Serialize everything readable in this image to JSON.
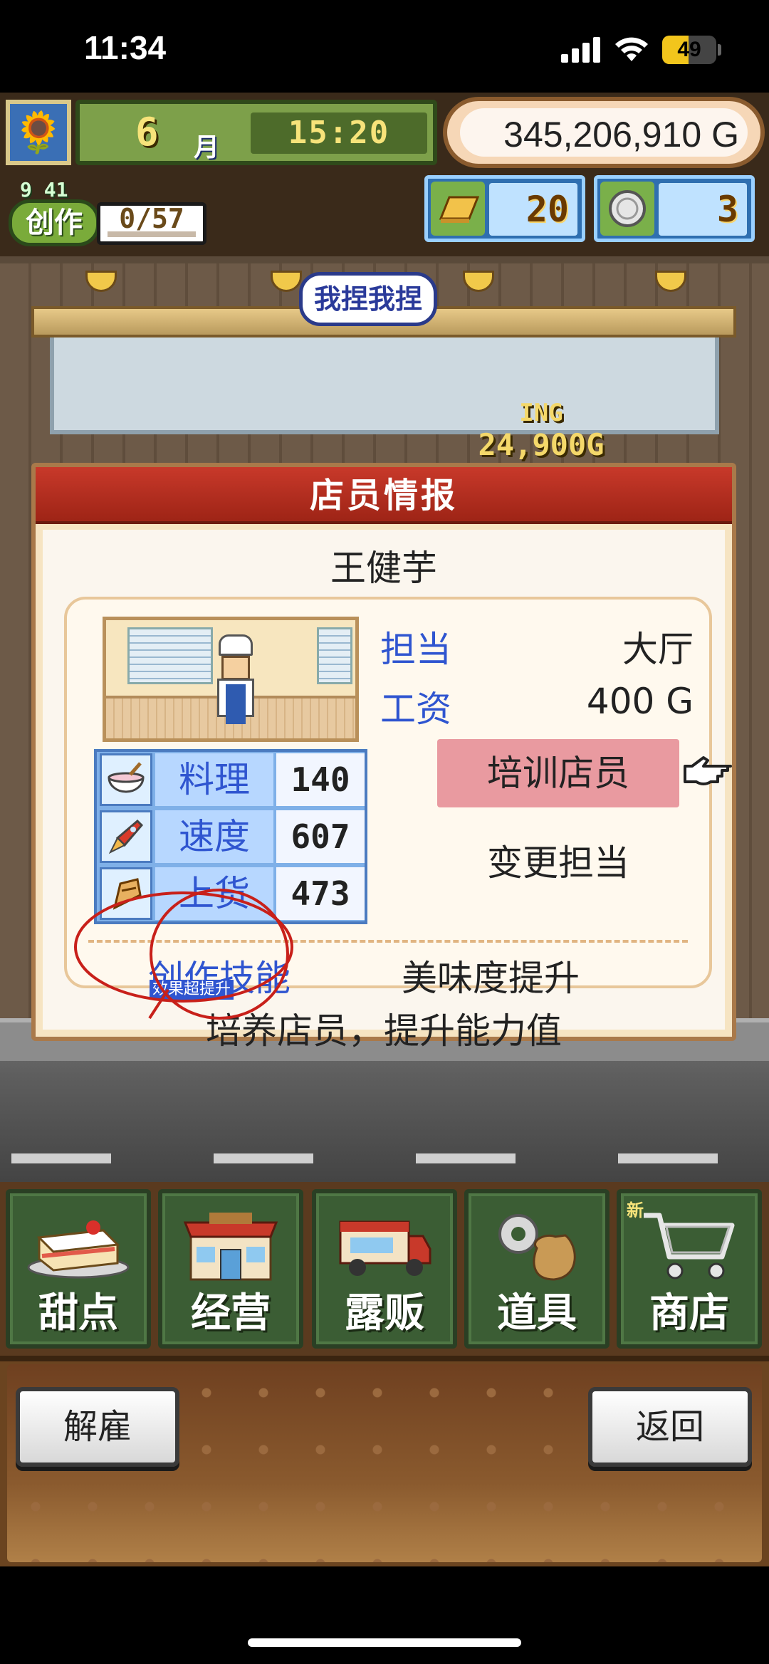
{
  "status_bar": {
    "time": "11:34",
    "battery": "49",
    "battery_fraction": 0.49
  },
  "hud": {
    "month_number": "6",
    "month_label": "月",
    "clock": "15:20",
    "money": "345,206,910 G",
    "create_time": "9 41",
    "create_label": "创作",
    "create_count": "0/57",
    "create_progress_fraction": 0.0,
    "gold_bars": "20",
    "coins": "3"
  },
  "scene": {
    "speech": "我捏我捏",
    "float_line1": "ING",
    "float_line2": "24,900G"
  },
  "dialog": {
    "title": "店员情报",
    "staff_name": "王健芋",
    "role_label": "担当",
    "role_value": "大厅",
    "salary_label": "工资",
    "salary_value": "400 G",
    "stats": [
      {
        "name": "料理",
        "value": "140",
        "icon": "cooking-bowl-icon"
      },
      {
        "name": "速度",
        "value": "607",
        "icon": "rocket-icon"
      },
      {
        "name": "上货",
        "value": "473",
        "icon": "stock-bag-icon"
      }
    ],
    "train_button": "培训店员",
    "change_button": "变更担当",
    "skill_label": "创作技能",
    "skill_badge": "效果超提升",
    "skill_value": "美味度提升",
    "hint": "培养店员，提升能力值"
  },
  "menu": {
    "new_badge": "新",
    "items": [
      {
        "label": "甜点",
        "icon": "cake-icon"
      },
      {
        "label": "经营",
        "icon": "shop-building-icon"
      },
      {
        "label": "露贩",
        "icon": "food-truck-icon"
      },
      {
        "label": "道具",
        "icon": "gear-sack-icon"
      },
      {
        "label": "商店",
        "icon": "shopping-cart-icon"
      }
    ]
  },
  "footer": {
    "dismiss": "解雇",
    "back": "返回"
  },
  "colors": {
    "accent_blue": "#2f55d0",
    "header_red": "#b52d1e",
    "train_pink": "#e99aa0",
    "menu_green": "#3b5d34"
  }
}
